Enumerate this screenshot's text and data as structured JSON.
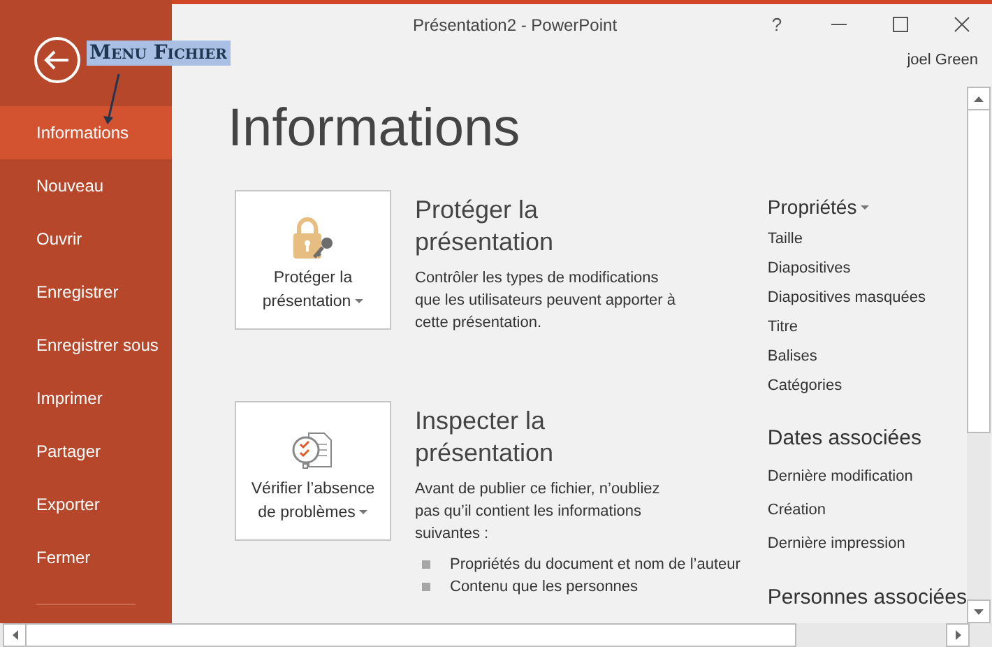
{
  "window": {
    "title": "Présentation2 - PowerPoint",
    "help": "?"
  },
  "user": "joel Green",
  "callout": {
    "text": "Menu Fichier"
  },
  "sidebar": {
    "items": [
      {
        "label": "Informations",
        "selected": true
      },
      {
        "label": "Nouveau",
        "selected": false
      },
      {
        "label": "Ouvrir",
        "selected": false
      },
      {
        "label": "Enregistrer",
        "selected": false
      },
      {
        "label": "Enregistrer sous",
        "selected": false
      },
      {
        "label": "Imprimer",
        "selected": false
      },
      {
        "label": "Partager",
        "selected": false
      },
      {
        "label": "Exporter",
        "selected": false
      },
      {
        "label": "Fermer",
        "selected": false
      }
    ]
  },
  "page_title": "Informations",
  "sections": [
    {
      "kind": "protect",
      "button": "Protéger la présentation",
      "heading": "Protéger la présentation",
      "description": "Contrôler les types de modifications que les utilisateurs peuvent apporter à cette présentation."
    },
    {
      "kind": "inspect",
      "button": "Vérifier l’absence de problèmes",
      "heading": "Inspecter la présentation",
      "description": "Avant de publier ce fichier, n’oubliez pas qu’il contient les informations suivantes :",
      "bullets": [
        "Propriétés du document et nom de l’auteur",
        "Contenu que les personnes"
      ]
    }
  ],
  "properties": [
    {
      "heading": "Propriétés",
      "dropdown": true,
      "items": [
        "Taille",
        "Diapositives",
        "Diapositives masquées",
        "Titre",
        "Balises",
        "Catégories"
      ]
    },
    {
      "heading": "Dates associées",
      "dropdown": false,
      "items": [
        "Dernière modification",
        "Création",
        "Dernière impression"
      ]
    },
    {
      "heading": "Personnes associées",
      "dropdown": false
    }
  ]
}
